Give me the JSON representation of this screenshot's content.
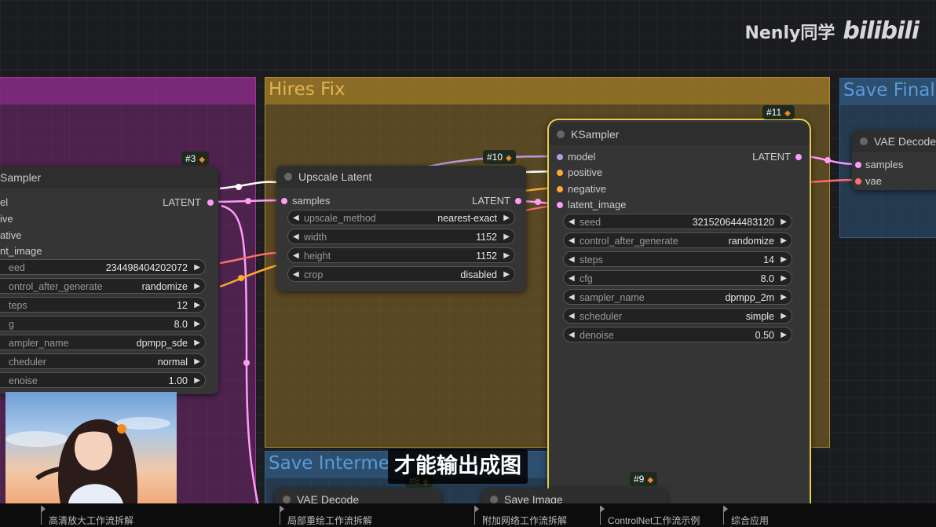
{
  "watermark": {
    "author": "Nenly同学",
    "site": "bilibili"
  },
  "subtitle": "才能输出成图",
  "groups": {
    "hires_fix": {
      "title": "Hires Fix"
    },
    "save_final": {
      "title": "Save Final"
    },
    "save_intermediate": {
      "title": "Save Interme"
    }
  },
  "ksampler_left": {
    "badge": "#3",
    "title": "Sampler",
    "inputs": [
      "el",
      "ive",
      "ative",
      "nt_image"
    ],
    "output": "LATENT",
    "widgets": [
      {
        "label": "eed",
        "value": "234498404202072"
      },
      {
        "label": "ontrol_after_generate",
        "value": "randomize"
      },
      {
        "label": "teps",
        "value": "12"
      },
      {
        "label": "g",
        "value": "8.0"
      },
      {
        "label": "ampler_name",
        "value": "dpmpp_sde"
      },
      {
        "label": "cheduler",
        "value": "normal"
      },
      {
        "label": "enoise",
        "value": "1.00"
      }
    ]
  },
  "upscale_latent": {
    "badge": "#10",
    "title": "Upscale Latent",
    "input": "samples",
    "output": "LATENT",
    "widgets": [
      {
        "label": "upscale_method",
        "value": "nearest-exact"
      },
      {
        "label": "width",
        "value": "1152"
      },
      {
        "label": "height",
        "value": "1152"
      },
      {
        "label": "crop",
        "value": "disabled"
      }
    ]
  },
  "ksampler_right": {
    "badge": "#11",
    "title": "KSampler",
    "inputs": [
      "model",
      "positive",
      "negative",
      "latent_image"
    ],
    "output": "LATENT",
    "widgets": [
      {
        "label": "seed",
        "value": "321520644483120"
      },
      {
        "label": "control_after_generate",
        "value": "randomize"
      },
      {
        "label": "steps",
        "value": "14"
      },
      {
        "label": "cfg",
        "value": "8.0"
      },
      {
        "label": "sampler_name",
        "value": "dpmpp_2m"
      },
      {
        "label": "scheduler",
        "value": "simple"
      },
      {
        "label": "denoise",
        "value": "0.50"
      }
    ]
  },
  "vae_decode_right": {
    "title": "VAE Decode",
    "inputs": [
      "samples",
      "vae"
    ]
  },
  "vae_decode_bottom": {
    "title": "VAE Decode",
    "badge": "#8"
  },
  "save_image_bottom": {
    "title": "Save Image",
    "badge": "#9"
  },
  "chapters": [
    "高清放大工作流拆解",
    "局部重绘工作流拆解",
    "附加网络工作流拆解",
    "ControlNet工作流示例",
    "综合应用"
  ],
  "colors": {
    "latent_pin": "#ff9cf9",
    "model_pin": "#b39ddb",
    "positive_pin": "#ffffff",
    "negative_pin": "#ffa931",
    "vae_pin": "#ff6e6e",
    "hires_group": "#b58b2a",
    "purple_group": "#a1309b",
    "blue_group": "#335f8a"
  },
  "icons": {
    "badge": "fox-icon",
    "left_arrow": "triangle-left-icon",
    "right_arrow": "triangle-right-icon"
  }
}
